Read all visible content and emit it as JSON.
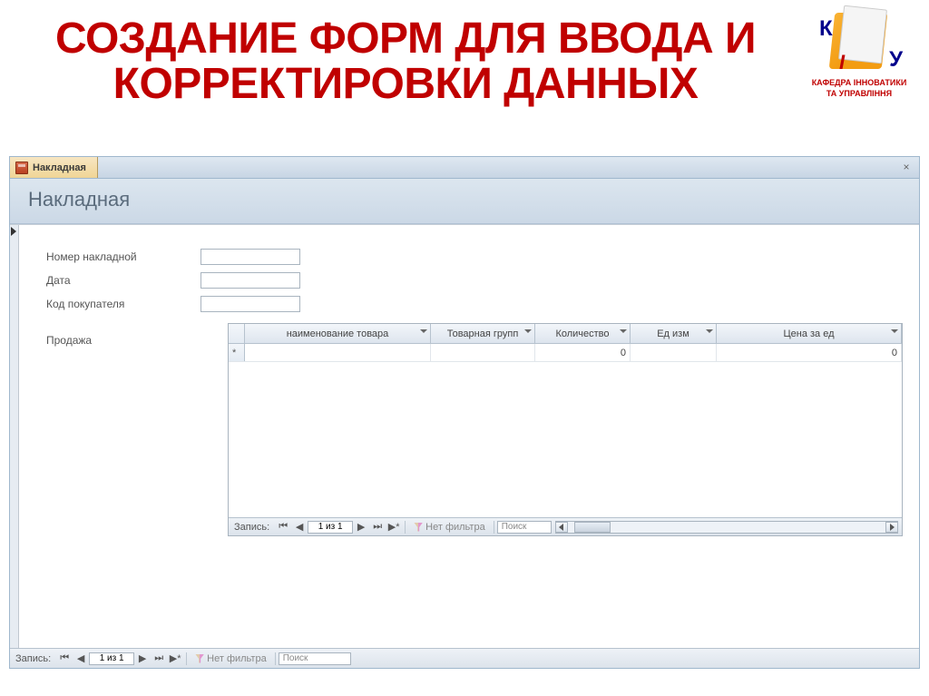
{
  "slide": {
    "title": "СОЗДАНИЕ ФОРМ ДЛЯ ВВОДА И КОРРЕКТИРОВКИ ДАННЫХ"
  },
  "logo": {
    "line1": "КАФЕДРА ІННОВАТИКИ",
    "line2": "ТА УПРАВЛІННЯ",
    "k": "К",
    "i": "І",
    "u": "У"
  },
  "window": {
    "tab_title": "Накладная",
    "close_symbol": "×",
    "header_title": "Накладная"
  },
  "fields": {
    "invoice_no": {
      "label": "Номер накладной",
      "value": ""
    },
    "date": {
      "label": "Дата",
      "value": ""
    },
    "buyer_code": {
      "label": "Код покупателя",
      "value": ""
    }
  },
  "subform": {
    "label": "Продажа",
    "columns": {
      "name": "наименование товара",
      "group": "Товарная групп",
      "qty": "Количество",
      "unit": "Ед изм",
      "price": "Цена за ед"
    },
    "new_row": {
      "marker": "*",
      "qty": "0",
      "price": "0"
    }
  },
  "nav": {
    "record_label": "Запись:",
    "first": "⏮",
    "prev": "◀",
    "position": "1 из 1",
    "next": "▶",
    "last": "⏭",
    "new": "▶*",
    "no_filter": "Нет фильтра",
    "search": "Поиск"
  }
}
